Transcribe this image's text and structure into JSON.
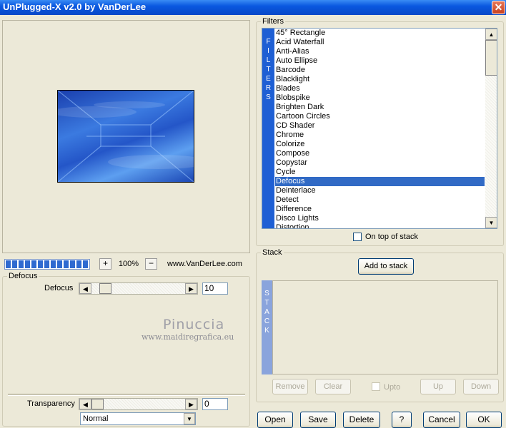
{
  "window": {
    "title": "UnPlugged-X v2.0 by VanDerLee",
    "close_glyph": "✕"
  },
  "preview": {
    "progress_fraction": 1.0,
    "zoom_minus": "−",
    "zoom_plus": "+",
    "zoom": "100%",
    "website": "www.VanDerLee.com"
  },
  "watermark": {
    "line1": "Pinuccia",
    "line2": "www.maidiregrafica.eu"
  },
  "defocus_group": {
    "title": "Defocus",
    "param_label": "Defocus",
    "param_value": "10",
    "param_fraction": 0.1,
    "left_arrow": "◀",
    "right_arrow": "▶"
  },
  "transparency": {
    "label": "Transparency",
    "value": "0",
    "fraction": 0.0,
    "mode": "Normal"
  },
  "filters": {
    "title": "Filters",
    "strip": [
      "F",
      "I",
      "L",
      "T",
      "E",
      "R",
      "S"
    ],
    "items": [
      "45° Rectangle",
      "Acid Waterfall",
      "Anti-Alias",
      "Auto Ellipse",
      "Barcode",
      "Blacklight",
      "Blades",
      "Blobspike",
      "Brighten Dark",
      "Cartoon Circles",
      "CD Shader",
      "Chrome",
      "Colorize",
      "Compose",
      "Copystar",
      "Cycle",
      "Defocus",
      "Deinterlace",
      "Detect",
      "Difference",
      "Disco Lights",
      "Distortion"
    ],
    "selected": "Defocus",
    "on_top_label": "On top of stack",
    "scroll_up": "▲",
    "scroll_down": "▼"
  },
  "stack": {
    "title": "Stack",
    "add_label": "Add to stack",
    "strip": [
      "S",
      "T",
      "A",
      "C",
      "K"
    ],
    "remove": "Remove",
    "clear": "Clear",
    "upto": "Upto",
    "up": "Up",
    "down": "Down"
  },
  "buttons": {
    "open": "Open",
    "save": "Save",
    "delete": "Delete",
    "help": "?",
    "cancel": "Cancel",
    "ok": "OK"
  },
  "colors": {
    "selection": "#316ac5",
    "filter_strip": "#1e5fd4",
    "stack_strip": "#8aa4dc"
  }
}
